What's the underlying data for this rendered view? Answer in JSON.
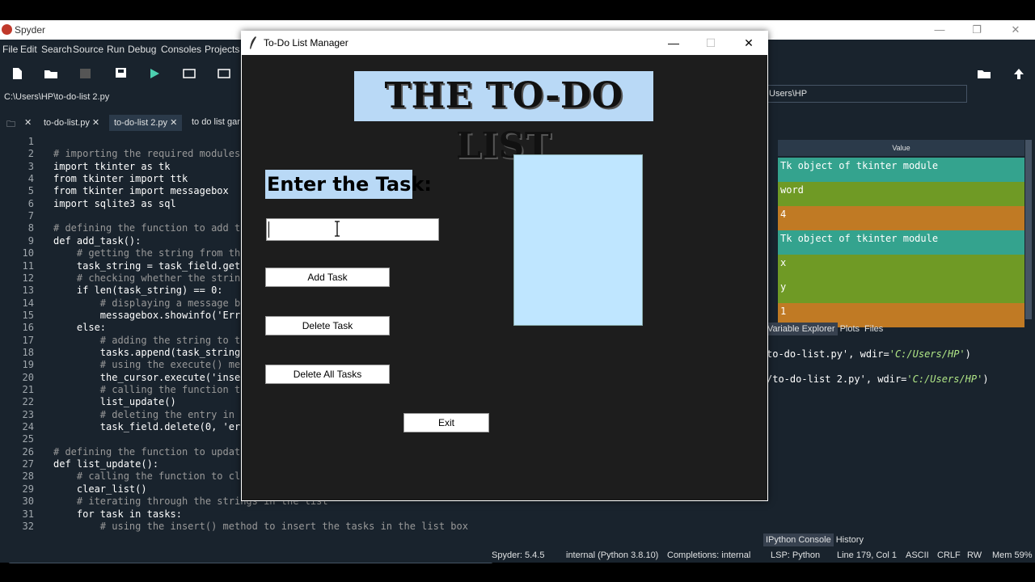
{
  "spyder": {
    "title": "Spyder",
    "menu": [
      "File",
      "Edit",
      "Search",
      "Source",
      "Run",
      "Debug",
      "Consoles",
      "Projects"
    ],
    "file_path": "C:\\Users\\HP\\to-do-list 2.py",
    "tabs": [
      "to-do-list.py",
      "to-do-list 2.py",
      "to do list gar"
    ],
    "active_tab": "to-do-list 2.py",
    "working_dir": "Users\\HP",
    "var_header": "Value",
    "variables": [
      {
        "value": "Tk object of tkinter module",
        "color": "#34a38e"
      },
      {
        "value": "word",
        "color": "#6f9a25"
      },
      {
        "value": "4",
        "color": "#c07a24"
      },
      {
        "value": "Tk object of tkinter module",
        "color": "#34a38e"
      },
      {
        "value": "x",
        "color": "#6f9a25"
      },
      {
        "value": "y",
        "color": "#6f9a25"
      },
      {
        "value": "1",
        "color": "#c07a24"
      }
    ],
    "pane_tabs": [
      "Variable Explorer",
      "Plots",
      "Files"
    ],
    "console_lines": [
      {
        "pre": "to-do-list.py', wdir=",
        "str": "'C:/Users/HP'",
        "post": ")"
      },
      {
        "pre": "/to-do-list 2.py', wdir=",
        "str": "'C:/Users/HP'",
        "post": ")"
      }
    ],
    "console_tabs": [
      "IPython Console",
      "History"
    ],
    "status": {
      "version": "Spyder: 5.4.5",
      "interpreter": "internal (Python 3.8.10)",
      "completions": "Completions: internal",
      "lsp": "LSP: Python",
      "position": "Line 179, Col 1",
      "encoding": "ASCII",
      "eol": "CRLF",
      "rw": "RW",
      "mem": "Mem 59%"
    }
  },
  "code": {
    "line_numbers": [
      "1",
      "2",
      "3",
      "4",
      "5",
      "6",
      "7",
      "8",
      "9",
      "10",
      "11",
      "12",
      "13",
      "14",
      "15",
      "16",
      "17",
      "18",
      "19",
      "20",
      "21",
      "22",
      "23",
      "24",
      "25",
      "26",
      "27",
      "28",
      "29",
      "30",
      "31",
      "32"
    ],
    "lines": [
      "",
      "# importing the required modules",
      "import tkinter as tk",
      "from tkinter import ttk",
      "from tkinter import messagebox",
      "import sqlite3 as sql",
      "",
      "# defining the function to add t",
      "def add_task():",
      "    # getting the string from th",
      "    task_string = task_field.get",
      "    # checking whether the strin",
      "    if len(task_string) == 0:",
      "        # displaying a message b",
      "        messagebox.showinfo('Err",
      "    else:",
      "        # adding the string to t",
      "        tasks.append(task_string",
      "        # using the execute() me",
      "        the_cursor.execute('inse",
      "        # calling the function t",
      "        list_update()",
      "        # deleting the entry in",
      "        task_field.delete(0, 'er",
      "",
      "# defining the function to updat",
      "def list_update():",
      "    # calling the function to cl",
      "    clear_list()",
      "    # iterating through the strings in the list",
      "    for task in tasks:",
      "        # using the insert() method to insert the tasks in the list box"
    ]
  },
  "tk": {
    "window_title": "To-Do List Manager",
    "heading": "THE TO-DO LIST",
    "enter_label": "Enter the Task:",
    "input_value": "",
    "buttons": {
      "add": "Add Task",
      "delete": "Delete Task",
      "delete_all": "Delete All Tasks",
      "exit": "Exit"
    },
    "minimize": "—",
    "maximize": "☐",
    "close": "✕"
  }
}
